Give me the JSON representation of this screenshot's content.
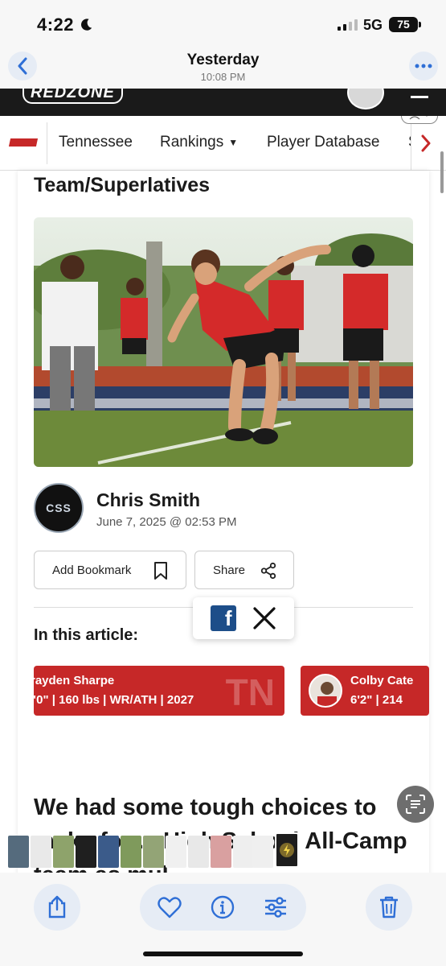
{
  "status_bar": {
    "time": "4:22",
    "network": "5G",
    "battery": "75"
  },
  "nav": {
    "title": "Yesterday",
    "subtitle": "10:08 PM"
  },
  "site": {
    "logo": "REDZONE"
  },
  "state_nav": {
    "items": [
      {
        "label": "Tennessee"
      },
      {
        "label": "Rankings"
      },
      {
        "label": "Player Database"
      },
      {
        "label": "S"
      }
    ]
  },
  "article": {
    "section_heading": "Team/Superlatives",
    "author_name": "Chris Smith",
    "author_avatar_text": "CSS",
    "date": "June 7, 2025 @ 02:53 PM",
    "bookmark_label": "Add Bookmark",
    "share_label": "Share",
    "in_article_label": "In this article:",
    "players": [
      {
        "name": "rayden Sharpe",
        "info": "\"0\" | 160 lbs | WR/ATH | 2027",
        "state": "TN"
      },
      {
        "name": "Colby Cate",
        "info": "6'2\" | 214"
      }
    ],
    "headline": "We had some tough choices to make for ... High School All-Camp team as mul..."
  },
  "colors": {
    "brand_red": "#c62828",
    "ios_blue": "#2f6fd6",
    "facebook_blue": "#1d4e89",
    "header_dark": "#1a1a1a"
  },
  "icons": {
    "back": "chevron-left-icon",
    "more": "ellipsis-icon",
    "bookmark": "bookmark-icon",
    "share": "share-icon",
    "facebook": "facebook-icon",
    "x": "x-icon",
    "live_text": "live-text-icon",
    "upload": "share-upload-icon",
    "favorite": "heart-icon",
    "info": "info-icon",
    "adjust": "sliders-icon",
    "delete": "trash-icon"
  }
}
